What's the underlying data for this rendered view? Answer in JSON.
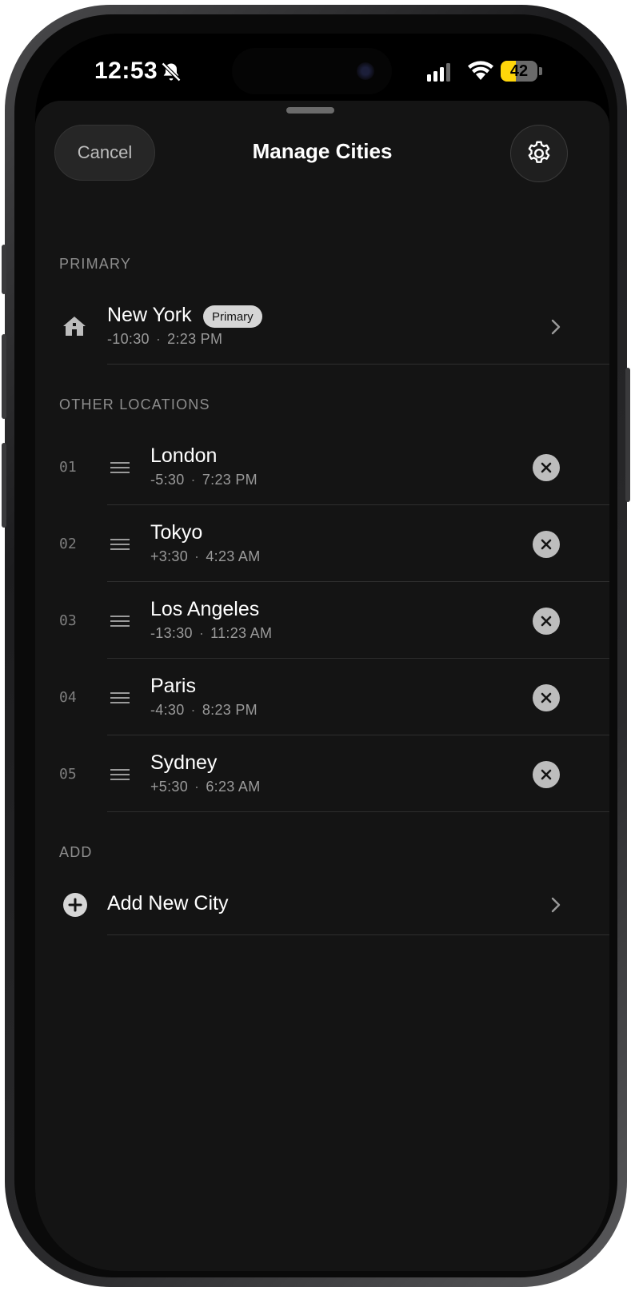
{
  "status_bar": {
    "time": "12:53",
    "battery_percent": "42",
    "battery_level": 0.42,
    "signal_bars_active": 3,
    "icons": [
      "bell-slash-icon",
      "cellular-signal-icon",
      "wifi-icon",
      "battery-icon"
    ]
  },
  "header": {
    "cancel_label": "Cancel",
    "title": "Manage Cities",
    "settings_icon": "gear-icon"
  },
  "primary_section": {
    "label": "PRIMARY",
    "city": {
      "name": "New York",
      "badge": "Primary",
      "offset": "-10:30",
      "time": "2:23 PM",
      "icon": "house-icon"
    }
  },
  "other_section": {
    "label": "OTHER LOCATIONS",
    "cities": [
      {
        "index": "01",
        "name": "London",
        "offset": "-5:30",
        "time": "7:23 PM"
      },
      {
        "index": "02",
        "name": "Tokyo",
        "offset": "+3:30",
        "time": "4:23 AM"
      },
      {
        "index": "03",
        "name": "Los Angeles",
        "offset": "-13:30",
        "time": "11:23 AM"
      },
      {
        "index": "04",
        "name": "Paris",
        "offset": "-4:30",
        "time": "8:23 PM"
      },
      {
        "index": "05",
        "name": "Sydney",
        "offset": "+5:30",
        "time": "6:23 AM"
      }
    ]
  },
  "add_section": {
    "label": "ADD",
    "add_label": "Add New City",
    "icon": "plus-circle-icon"
  },
  "colors": {
    "sheet_background": "#141414",
    "battery_fill": "#ffd60a",
    "text_primary": "#ffffff",
    "text_secondary": "#9a9a9a"
  }
}
